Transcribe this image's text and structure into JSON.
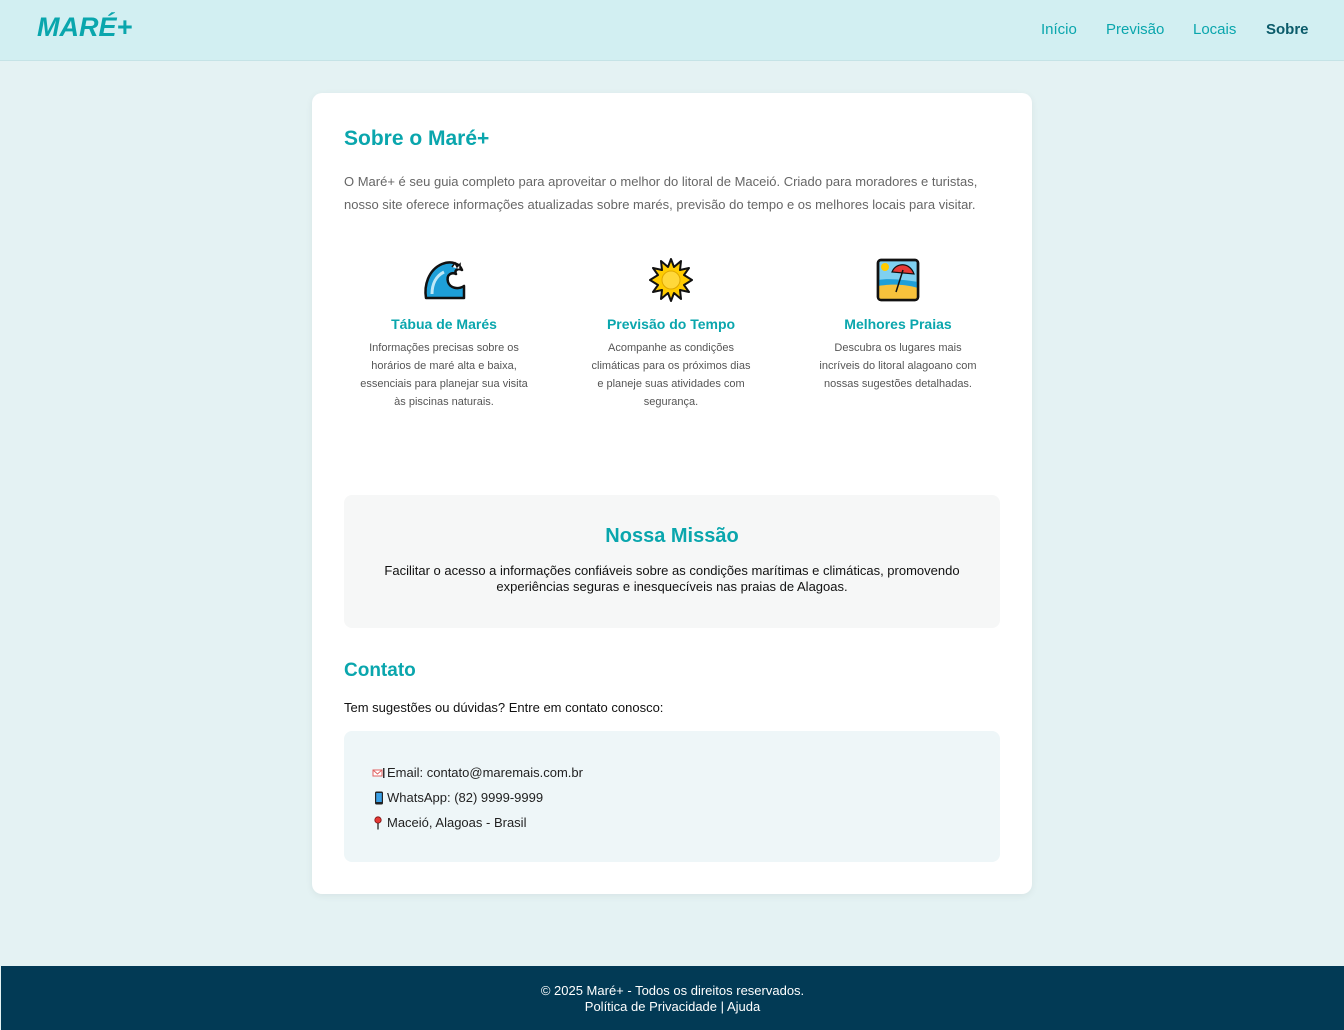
{
  "header": {
    "logo": "MARÉ+",
    "nav": [
      {
        "label": "Início",
        "active": false
      },
      {
        "label": "Previsão",
        "active": false
      },
      {
        "label": "Locais",
        "active": false
      },
      {
        "label": "Sobre",
        "active": true
      }
    ]
  },
  "about": {
    "title": "Sobre o Maré+",
    "intro": "O Maré+ é seu guia completo para aproveitar o melhor do litoral de Maceió. Criado para moradores e turistas, nosso site oferece informações atualizadas sobre marés, previsão do tempo e os melhores locais para visitar.",
    "features": [
      {
        "icon": "wave-icon",
        "title": "Tábua de Marés",
        "description": "Informações precisas sobre os horários de maré alta e baixa, essenciais para planejar sua visita às piscinas naturais."
      },
      {
        "icon": "sun-icon",
        "title": "Previsão do Tempo",
        "description": "Acompanhe as condições climáticas para os próximos dias e planeje suas atividades com segurança."
      },
      {
        "icon": "beach-umbrella-icon",
        "title": "Melhores Praias",
        "description": "Descubra os lugares mais incríveis do litoral alagoano com nossas sugestões detalhadas."
      }
    ]
  },
  "mission": {
    "title": "Nossa Missão",
    "text": "Facilitar o acesso a informações confiáveis sobre as condições marítimas e climáticas, promovendo experiências seguras e inesquecíveis nas praias de Alagoas."
  },
  "contact": {
    "title": "Contato",
    "intro": "Tem sugestões ou dúvidas? Entre em contato conosco:",
    "lines": [
      {
        "icon": "email-icon",
        "text": "Email: contato@maremais.com.br"
      },
      {
        "icon": "phone-icon",
        "text": "WhatsApp: (82) 9999-9999"
      },
      {
        "icon": "location-pin-icon",
        "text": "Maceió, Alagoas - Brasil"
      }
    ]
  },
  "footer": {
    "copyright": "© 2025 Maré+ - Todos os direitos reservados.",
    "privacy": "Política de Privacidade",
    "separator": "|",
    "help": "Ajuda"
  },
  "colors": {
    "accent": "#0aa6ad",
    "header_bg": "#d2eff2",
    "page_bg": "#e4f2f3",
    "footer_bg": "#023a55"
  }
}
